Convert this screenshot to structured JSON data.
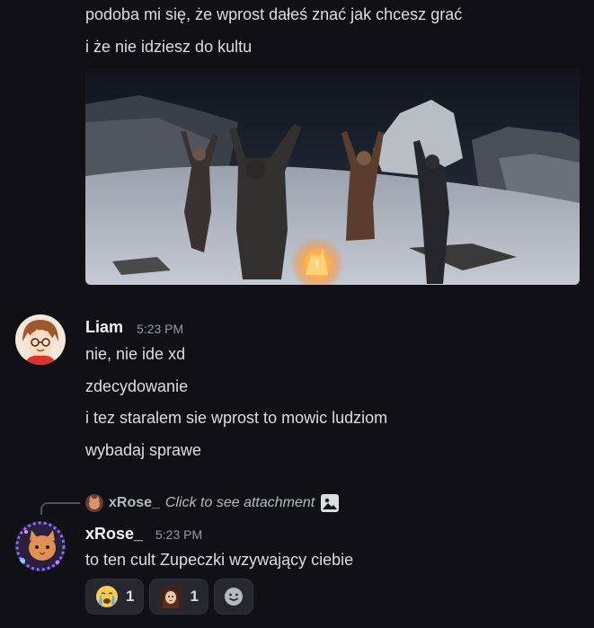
{
  "messages_top": {
    "line1": "podoba mi się, że wprost dałeś znać jak chcesz grać",
    "line2": "i że nie idziesz do kultu"
  },
  "liam": {
    "name": "Liam",
    "time": "5:23 PM",
    "lines": [
      "nie, nie ide xd",
      "zdecydowanie",
      "i tez staralem sie wprost to mowic ludziom",
      "wybadaj sprawe"
    ]
  },
  "reply": {
    "name": "xRose_",
    "text": "Click to see attachment"
  },
  "xrose": {
    "name": "xRose_",
    "time": "5:23 PM",
    "text": "to ten cult Zupeczki wzywający ciebie"
  },
  "reactions": [
    {
      "icon": "crying-emoji-icon",
      "count": "1"
    },
    {
      "icon": "custom-face-emoji-icon",
      "count": "1"
    }
  ]
}
